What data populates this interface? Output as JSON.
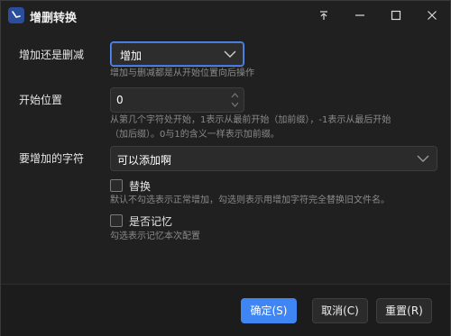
{
  "window": {
    "title": "增删转换"
  },
  "titlebar_buttons": [
    "pin-icon",
    "minimize-icon",
    "maximize-icon",
    "close-icon"
  ],
  "form": {
    "mode": {
      "label": "增加还是删减",
      "value": "增加",
      "help": "增加与删减都是从开始位置向后操作"
    },
    "start": {
      "label": "开始位置",
      "value": "0",
      "help_line1": "从第几个字符处开始，1表示从最前开始（加前缀），-1表示从最后开始",
      "help_line2": "（加后缀）。0与1的含义一样表示加前缀。"
    },
    "chars": {
      "label": "要增加的字符",
      "value": "可以添加啊"
    },
    "replace": {
      "label": "替换",
      "checked": false,
      "help": "默认不勾选表示正常增加，勾选则表示用增加字符完全替换旧文件名。"
    },
    "remember": {
      "label": "是否记忆",
      "checked": false,
      "help": "勾选表示记忆本次配置"
    }
  },
  "footer": {
    "ok_label": "确定(S)",
    "cancel_label": "取消(C)",
    "reset_label": "重置(R)"
  },
  "colors": {
    "accent": "#3f86f4",
    "background": "#202020",
    "help_text": "#8a8a8a"
  }
}
